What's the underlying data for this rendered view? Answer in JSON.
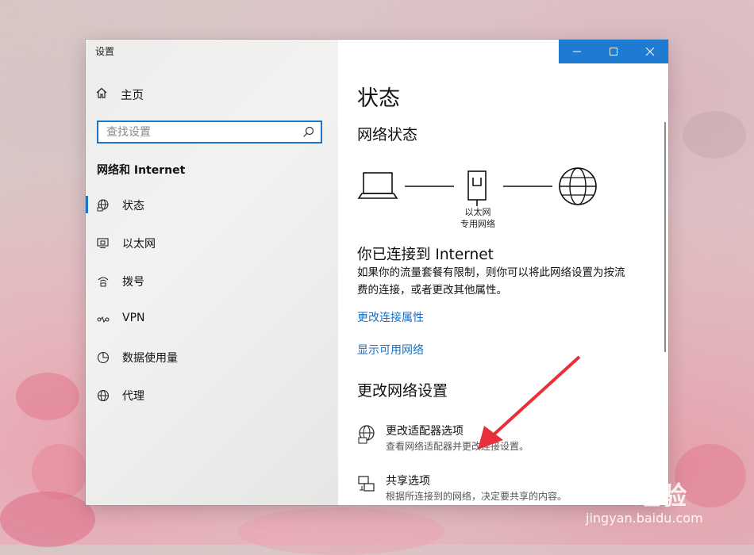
{
  "window": {
    "title": "设置",
    "accent": "#1b76c8",
    "caption_color": "#1f7ad1"
  },
  "sidebar": {
    "home_label": "主页",
    "search": {
      "placeholder": "查找设置"
    },
    "section_title": "网络和 Internet",
    "items": [
      {
        "label": "状态",
        "icon": "globe-status-icon",
        "active": true
      },
      {
        "label": "以太网",
        "icon": "ethernet-icon",
        "active": false
      },
      {
        "label": "拨号",
        "icon": "dialup-icon",
        "active": false
      },
      {
        "label": "VPN",
        "icon": "vpn-icon",
        "active": false
      },
      {
        "label": "数据使用量",
        "icon": "data-usage-icon",
        "active": false
      },
      {
        "label": "代理",
        "icon": "globe-proxy-icon",
        "active": false
      }
    ]
  },
  "main": {
    "page_title": "状态",
    "network_status_heading": "网络状态",
    "diagram_label_line1": "以太网",
    "diagram_label_line2": "专用网络",
    "connected_title": "你已连接到 Internet",
    "description_line1": "如果你的流量套餐有限制，则你可以将此网络设置为按流",
    "description_line2": "费的连接，或者更改其他属性。",
    "link_change_properties": "更改连接属性",
    "link_show_networks": "显示可用网络",
    "change_settings_heading": "更改网络设置",
    "options": [
      {
        "title": "更改适配器选项",
        "description": "查看网络适配器并更改连接设置。",
        "icon": "adapter-icon"
      },
      {
        "title": "共享选项",
        "description": "根据所连接到的网络，决定要共享的内容。",
        "icon": "sharing-icon"
      }
    ]
  },
  "watermark": {
    "logo_text": "Bai 经验",
    "url": "jingyan.baidu.com"
  }
}
